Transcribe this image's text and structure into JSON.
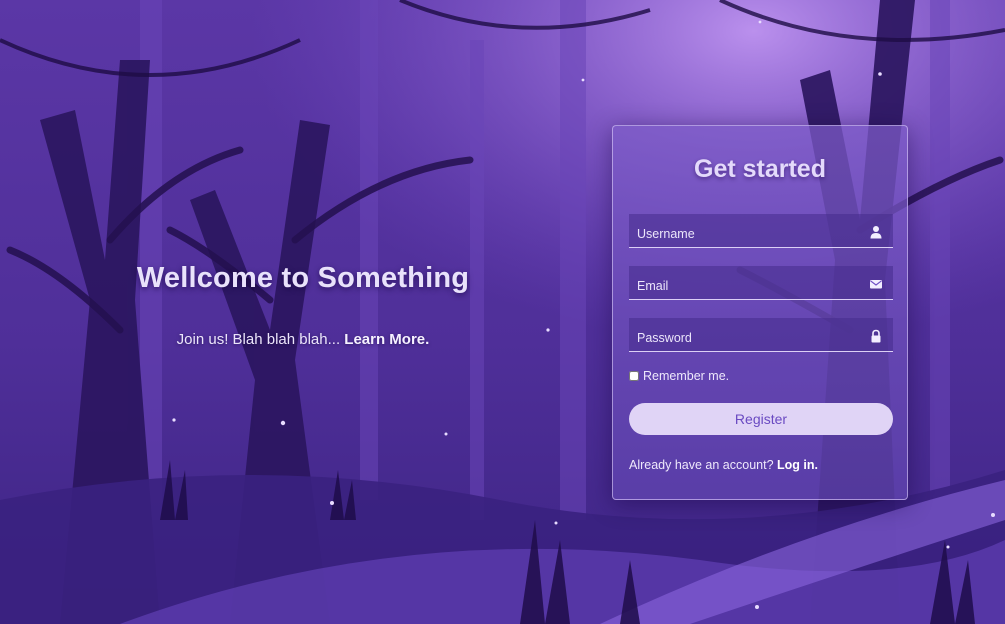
{
  "colors": {
    "accent": "#e0d4f6",
    "button_text": "#6a4ac2",
    "background": "#4a2c8f"
  },
  "hero": {
    "title": "Wellcome to Something",
    "subtitle": "Join us! Blah blah blah...",
    "link": "Learn More."
  },
  "form": {
    "title": "Get started",
    "username": {
      "placeholder": "Username",
      "value": "",
      "icon": "user-icon"
    },
    "email": {
      "placeholder": "Email",
      "value": "",
      "icon": "envelope-icon"
    },
    "password": {
      "placeholder": "Password",
      "value": "",
      "icon": "lock-icon"
    },
    "remember_label": "Remember me.",
    "remember_checked": false,
    "submit_label": "Register",
    "login_prompt": "Already have an account?",
    "login_link": "Log in."
  }
}
